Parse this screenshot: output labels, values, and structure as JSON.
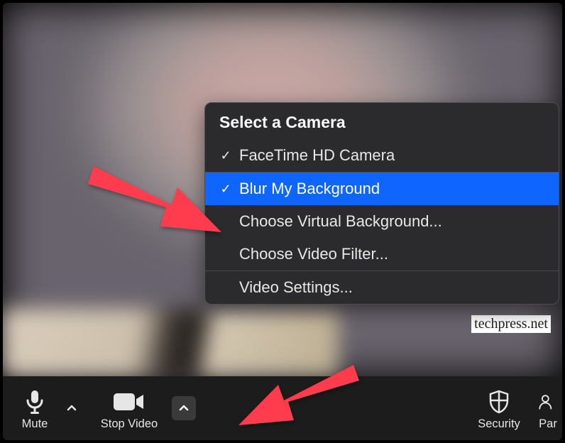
{
  "toolbar": {
    "mute": {
      "label": "Mute"
    },
    "video": {
      "label": "Stop Video"
    },
    "security": {
      "label": "Security"
    },
    "participants": {
      "label": "Par"
    }
  },
  "popup": {
    "header": "Select a Camera",
    "camera_option": "FaceTime HD Camera",
    "blur": "Blur My Background",
    "virtual_bg": "Choose Virtual Background...",
    "video_filter": "Choose Video Filter...",
    "video_settings": "Video Settings..."
  },
  "watermark": "techpress.net",
  "colors": {
    "highlight": "#0f66ff",
    "arrow": "#ff3b4e"
  }
}
